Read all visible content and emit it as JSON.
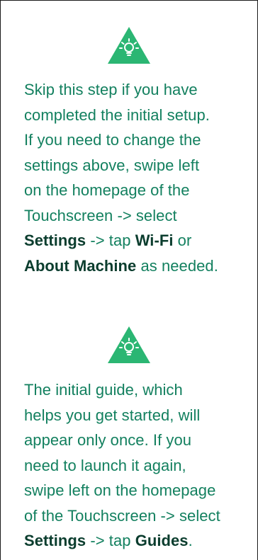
{
  "colors": {
    "body_text": "#13805f",
    "emphasis_text": "#0b3d2e",
    "icon_fill": "#2bb673",
    "icon_glyph": "#ffffff"
  },
  "tips": [
    {
      "icon": "lightbulb-icon",
      "lines": [
        [
          {
            "t": "Skip this step if you have"
          }
        ],
        [
          {
            "t": "completed the initial setup."
          }
        ],
        [
          {
            "t": "If you need to change the"
          }
        ],
        [
          {
            "t": "settings above, swipe left"
          }
        ],
        [
          {
            "t": "on the homepage of the"
          }
        ],
        [
          {
            "t": "Touchscreen -> select"
          }
        ],
        [
          {
            "t": "Settings",
            "b": true
          },
          {
            "t": " -> tap "
          },
          {
            "t": "Wi-Fi",
            "b": true
          },
          {
            "t": " or"
          }
        ],
        [
          {
            "t": "About Machine",
            "b": true
          },
          {
            "t": " as needed."
          }
        ]
      ]
    },
    {
      "icon": "lightbulb-icon",
      "lines": [
        [
          {
            "t": "The initial guide, which"
          }
        ],
        [
          {
            "t": "helps you get started, will"
          }
        ],
        [
          {
            "t": "appear only once. If you"
          }
        ],
        [
          {
            "t": "need to launch it again,"
          }
        ],
        [
          {
            "t": "swipe left on the homepage"
          }
        ],
        [
          {
            "t": "of the Touchscreen -> select"
          }
        ],
        [
          {
            "t": "Settings",
            "b": true
          },
          {
            "t": " -> tap "
          },
          {
            "t": "Guides",
            "b": true
          },
          {
            "t": "."
          }
        ]
      ]
    }
  ]
}
